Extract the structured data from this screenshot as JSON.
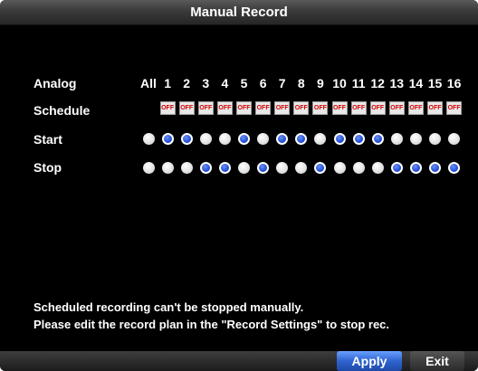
{
  "dialog": {
    "title": "Manual Record",
    "row_labels": {
      "analog": "Analog",
      "schedule": "Schedule",
      "start": "Start",
      "stop": "Stop"
    },
    "all_label": "All",
    "channels": [
      "1",
      "2",
      "3",
      "4",
      "5",
      "6",
      "7",
      "8",
      "9",
      "10",
      "11",
      "12",
      "13",
      "14",
      "15",
      "16"
    ],
    "schedule_badge": "OFF",
    "start_states": [
      "on",
      "off",
      "off",
      "on",
      "on",
      "off",
      "on",
      "off",
      "off",
      "on",
      "off",
      "off",
      "off",
      "on",
      "on",
      "on",
      "on"
    ],
    "stop_states": [
      "on",
      "on",
      "on",
      "off",
      "off",
      "on",
      "off",
      "on",
      "on",
      "off",
      "on",
      "on",
      "on",
      "off",
      "off",
      "off",
      "off"
    ],
    "notes": [
      "Scheduled recording can't be stopped manually.",
      "Please edit the record plan in the \"Record Settings\" to stop rec."
    ],
    "buttons": {
      "apply": "Apply",
      "exit": "Exit"
    },
    "colors": {
      "active_dot": "#1a4ad8",
      "inactive_dot": "#ffffff",
      "off_badge_text": "#d40000"
    }
  }
}
